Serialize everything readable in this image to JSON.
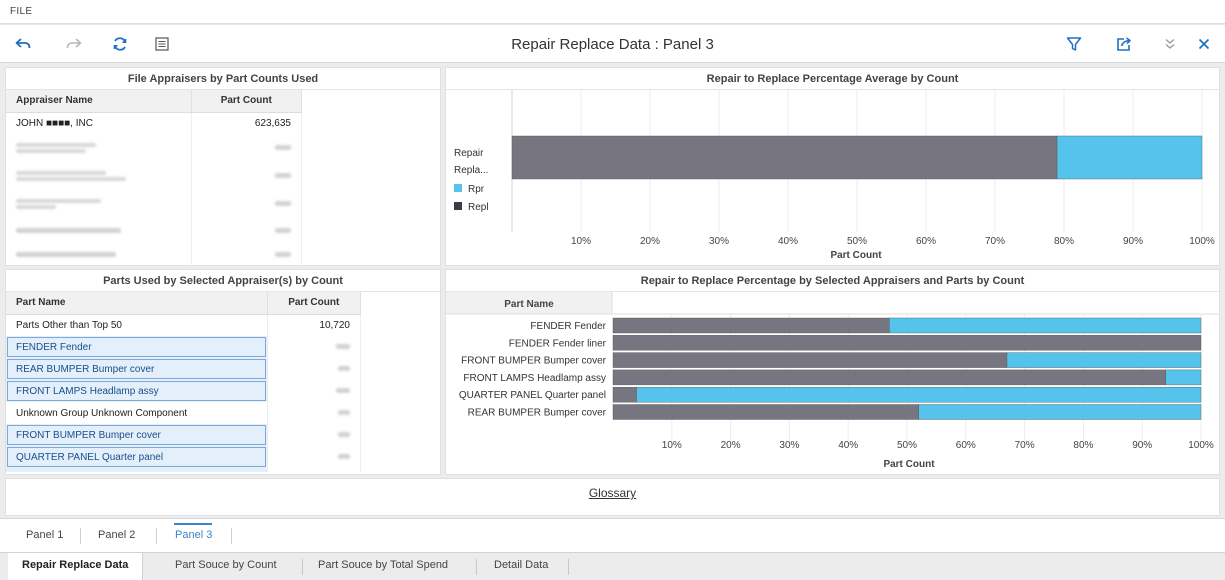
{
  "menu": {
    "file_label": "FILE"
  },
  "toolbar": {
    "title": "Repair Replace Data : Panel 3",
    "icons": [
      "undo-icon",
      "redo-icon",
      "refresh-icon",
      "notes-icon",
      "filter-icon",
      "export-icon",
      "collapse-icon",
      "close-icon"
    ],
    "accent_color": "#1f6fc7"
  },
  "appraisers_panel": {
    "title": "File Appraisers by Part Counts Used",
    "columns": [
      "Appraiser Name",
      "Part Count"
    ],
    "rows": [
      {
        "name": "JOHN ■■■■, INC",
        "count": "623,635"
      }
    ],
    "redacted_rows": 5
  },
  "avg_chart_panel": {
    "title": "Repair to Replace Percentage Average by Count",
    "legend": [
      {
        "label": "Rpr",
        "color": "#55c3ec"
      },
      {
        "label": "Repl",
        "color": "#3c3c46"
      }
    ],
    "category_label": [
      "Repair",
      "Repla..."
    ]
  },
  "parts_panel": {
    "title": "Parts Used by Selected Appraiser(s) by Count",
    "columns": [
      "Part Name",
      "Part Count"
    ],
    "rows": [
      {
        "name": "Parts Other than Top 50",
        "count": "10,720",
        "selected": false
      },
      {
        "name": "FENDER Fender",
        "count": "",
        "selected": true
      },
      {
        "name": "REAR BUMPER Bumper cover",
        "count": "",
        "selected": true
      },
      {
        "name": "FRONT LAMPS Headlamp assy",
        "count": "",
        "selected": true
      },
      {
        "name": "Unknown Group Unknown Component",
        "count": "",
        "selected": false
      },
      {
        "name": "FRONT BUMPER Bumper cover",
        "count": "",
        "selected": true
      },
      {
        "name": "QUARTER PANEL Quarter panel",
        "count": "",
        "selected": true
      }
    ]
  },
  "parts_chart_panel": {
    "title": "Repair to Replace Percentage by Selected Appraisers and Parts by Count",
    "row_header": "Part Name"
  },
  "chart_data": [
    {
      "type": "bar",
      "orientation": "horizontal",
      "stacked": true,
      "title": "Repair to Replace Percentage Average by Count",
      "categories": [
        "Repair Repla..."
      ],
      "series": [
        {
          "name": "Repl",
          "values": [
            79
          ],
          "color": "#77757f"
        },
        {
          "name": "Rpr",
          "values": [
            21
          ],
          "color": "#55c3ec"
        }
      ],
      "xlabel": "Part Count",
      "ylabel": "",
      "xlim": [
        0,
        100
      ],
      "xticks": [
        "10%",
        "20%",
        "30%",
        "40%",
        "50%",
        "60%",
        "70%",
        "80%",
        "90%",
        "100%"
      ],
      "legend": "left"
    },
    {
      "type": "bar",
      "orientation": "horizontal",
      "stacked": true,
      "title": "Repair to Replace Percentage by Selected Appraisers and Parts by Count",
      "categories": [
        "FENDER Fender",
        "FENDER Fender liner",
        "FRONT BUMPER Bumper cover",
        "FRONT LAMPS Headlamp assy",
        "QUARTER PANEL Quarter panel",
        "REAR BUMPER Bumper cover"
      ],
      "series": [
        {
          "name": "Repl",
          "values": [
            47,
            100,
            67,
            94,
            4,
            52
          ],
          "color": "#77757f"
        },
        {
          "name": "Rpr",
          "values": [
            53,
            0,
            33,
            6,
            96,
            48
          ],
          "color": "#55c3ec"
        }
      ],
      "xlabel": "Part Count",
      "ylabel": "Part Name",
      "xlim": [
        0,
        100
      ],
      "xticks": [
        "10%",
        "20%",
        "30%",
        "40%",
        "50%",
        "60%",
        "70%",
        "80%",
        "90%",
        "100%"
      ]
    }
  ],
  "glossary": {
    "label": "Glossary"
  },
  "panel_tabs": [
    {
      "label": "Panel 1",
      "active": false
    },
    {
      "label": "Panel 2",
      "active": false
    },
    {
      "label": "Panel 3",
      "active": true
    }
  ],
  "sheet_tabs": [
    {
      "label": "Repair Replace Data",
      "active": true
    },
    {
      "label": "Part Souce by Count",
      "active": false
    },
    {
      "label": "Part Souce by Total Spend",
      "active": false
    },
    {
      "label": "Detail Data",
      "active": false
    }
  ]
}
